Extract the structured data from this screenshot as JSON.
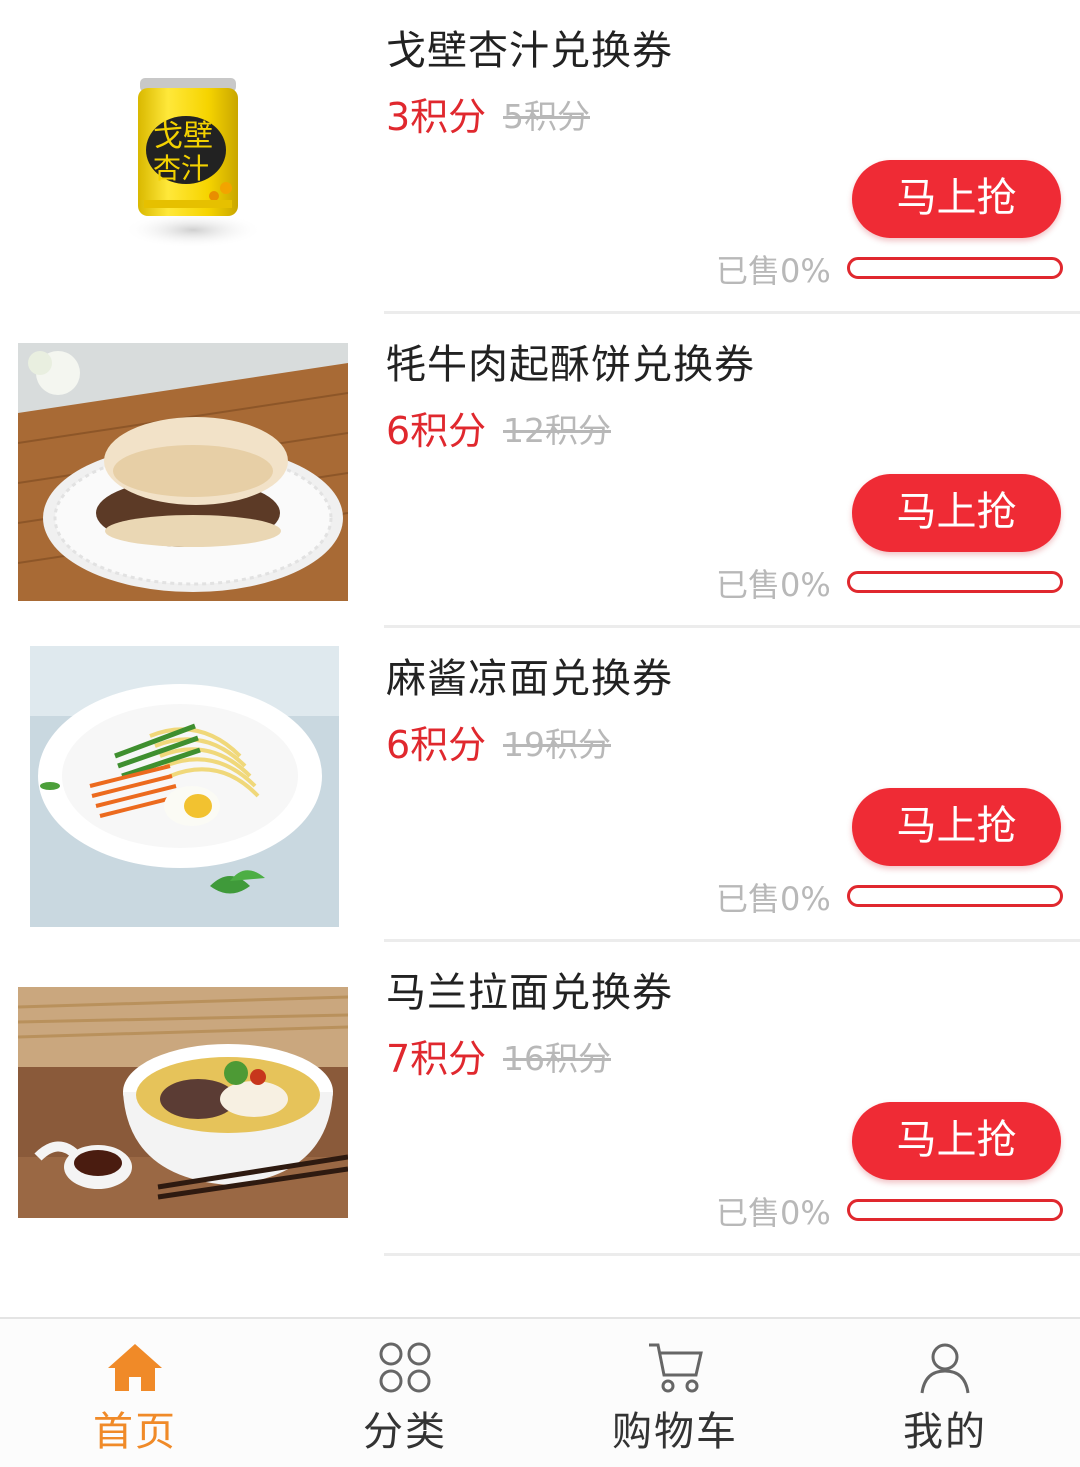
{
  "colors": {
    "accent": "#ef2b35",
    "price": "#e0282e",
    "muted": "#b8b8b8",
    "nav_active": "#f08a28"
  },
  "products": [
    {
      "title": "戈壁杏汁兑换券",
      "price": "3积分",
      "original_price": "5积分",
      "buy_label": "马上抢",
      "sold_text": "已售0%",
      "sold_fraction": 0,
      "image": "apricot-juice-can"
    },
    {
      "title": "牦牛肉起酥饼兑换券",
      "price": "6积分",
      "original_price": "12积分",
      "buy_label": "马上抢",
      "sold_text": "已售0%",
      "sold_fraction": 0,
      "image": "yak-meat-pastry"
    },
    {
      "title": "麻酱凉面兑换券",
      "price": "6积分",
      "original_price": "19积分",
      "buy_label": "马上抢",
      "sold_text": "已售0%",
      "sold_fraction": 0,
      "image": "sesame-cold-noodles"
    },
    {
      "title": "马兰拉面兑换券",
      "price": "7积分",
      "original_price": "16积分",
      "buy_label": "马上抢",
      "sold_text": "已售0%",
      "sold_fraction": 0,
      "image": "lanzhou-beef-noodles"
    }
  ],
  "nav": [
    {
      "label": "首页",
      "icon": "home-icon",
      "active": true
    },
    {
      "label": "分类",
      "icon": "category-icon",
      "active": false
    },
    {
      "label": "购物车",
      "icon": "cart-icon",
      "active": false
    },
    {
      "label": "我的",
      "icon": "user-icon",
      "active": false
    }
  ]
}
